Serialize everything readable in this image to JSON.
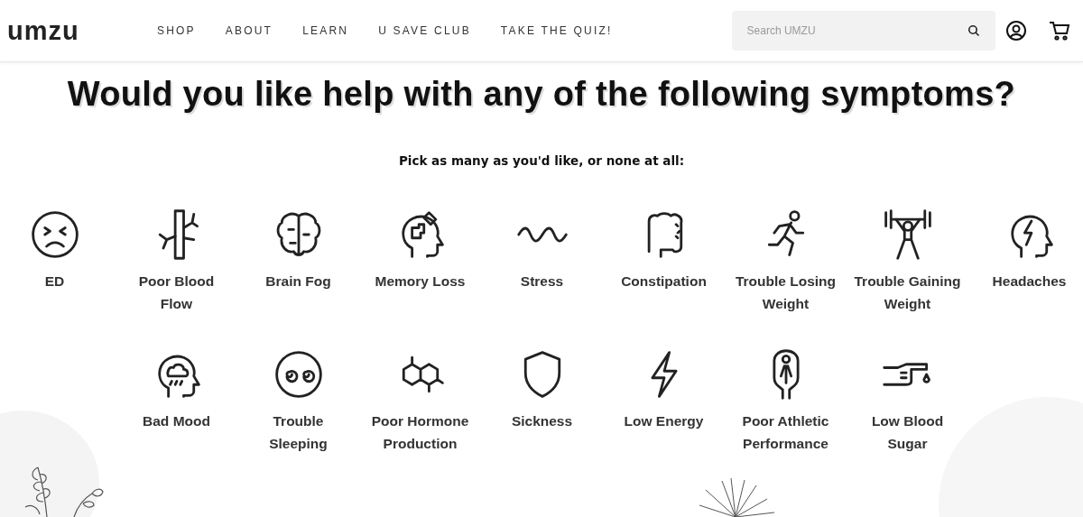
{
  "header": {
    "logo": "umzu",
    "nav": [
      {
        "label": "SHOP"
      },
      {
        "label": "ABOUT"
      },
      {
        "label": "LEARN"
      },
      {
        "label": "U SAVE CLUB"
      },
      {
        "label": "TAKE THE QUIZ!"
      }
    ],
    "search": {
      "placeholder": "Search UMZU"
    }
  },
  "question": {
    "title": "Would you like help with any of the following symptoms?",
    "subtitle": "Pick as many as you'd like, or none at all:"
  },
  "rows": [
    [
      {
        "label": "ED"
      },
      {
        "label": "Poor Blood Flow"
      },
      {
        "label": "Brain Fog"
      },
      {
        "label": "Memory Loss"
      },
      {
        "label": "Stress"
      },
      {
        "label": "Constipation"
      },
      {
        "label": "Trouble Losing Weight"
      },
      {
        "label": "Trouble Gaining Weight"
      },
      {
        "label": "Headaches"
      }
    ],
    [
      {
        "label": "Bad Mood"
      },
      {
        "label": "Trouble Sleeping"
      },
      {
        "label": "Poor Hormone Production"
      },
      {
        "label": "Sickness"
      },
      {
        "label": "Low Energy"
      },
      {
        "label": "Poor Athletic Performance"
      },
      {
        "label": "Low Blood Sugar"
      }
    ]
  ]
}
